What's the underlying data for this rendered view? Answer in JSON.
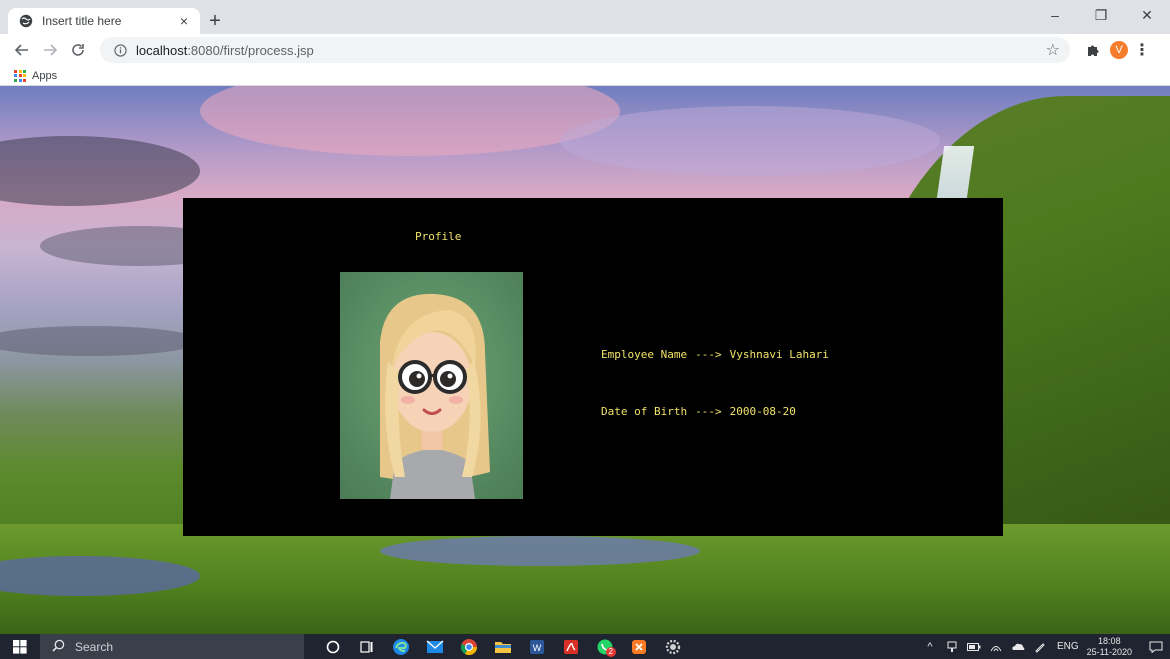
{
  "browser": {
    "tab_title": "Insert title here",
    "tab_close": "×",
    "new_tab": "+",
    "url_host": "localhost",
    "url_path": ":8080/first/process.jsp",
    "bookmarks_apps": "Apps",
    "profile_initial": "V",
    "window_controls": {
      "minimize": "–",
      "maximize": "❐",
      "close": "✕"
    }
  },
  "profile": {
    "title": "Profile",
    "employee_name_label": "Employee Name",
    "employee_name_arrow": "--->",
    "employee_name": "Vyshnavi Lahari",
    "dob_label": "Date of Birth",
    "dob_arrow": "--->",
    "dob": "2000-08-20"
  },
  "taskbar": {
    "search_placeholder": "Search",
    "language": "ENG",
    "time": "18:08",
    "date": "25-11-2020",
    "whatsapp_badge": "2"
  },
  "colors": {
    "card_text": "#f2e36a",
    "card_bg": "#000000",
    "profile_avatar": "#f57c2b"
  }
}
